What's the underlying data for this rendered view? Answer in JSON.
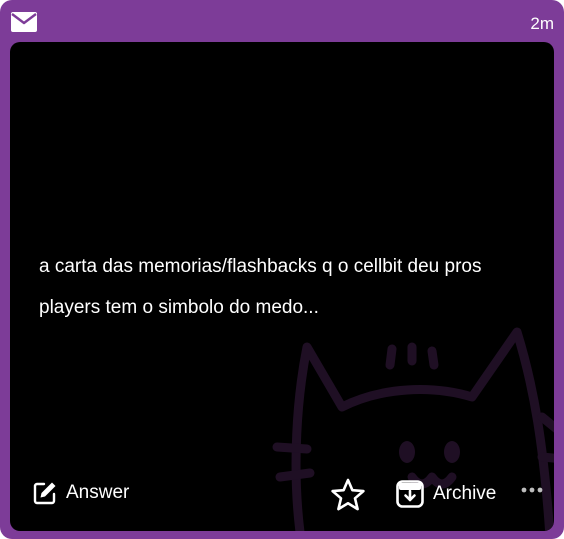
{
  "header": {
    "mail_icon": "envelope-icon",
    "time": "2m"
  },
  "question": {
    "text": "a carta das memorias/flashbacks q o cellbit deu pros players tem o simbolo do medo..."
  },
  "actions": {
    "answer_label": "Answer",
    "archive_label": "Archive",
    "icons": [
      "pencil-square-icon",
      "star-icon",
      "archive-box-icon",
      "more-dots-icon"
    ]
  },
  "theme": {
    "frame": "#7d3c98",
    "panel": "#000000",
    "text": "#ffffff",
    "watermark": "#1f0f24"
  }
}
